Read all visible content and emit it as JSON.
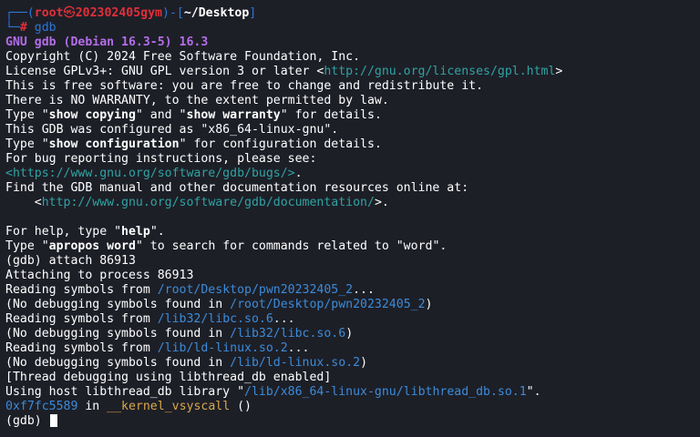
{
  "prompt": {
    "corner_top": "┌──(",
    "user": "root",
    "at": "㉿",
    "host": "202302405gym",
    "sep": ")-[",
    "cwd": "~/Desktop",
    "close": "]",
    "corner_bottom": "└─",
    "hash": "#",
    "command": "gdb"
  },
  "banner": {
    "title": "GNU gdb (Debian 16.3-5) 16.3",
    "copyright": "Copyright (C) 2024 Free Software Foundation, Inc.",
    "license_pre": "License GPLv3+: GNU GPL version 3 or later <",
    "license_url": "http://gnu.org/licenses/gpl.html",
    "license_post": ">",
    "free": "This is free software: you are free to change and redistribute it.",
    "warranty": "There is NO WARRANTY, to the extent permitted by law.",
    "type_pre": "Type \"",
    "show_copying": "show copying",
    "and_mid": "\" and \"",
    "show_warranty": "show warranty",
    "details_post": "\" for details.",
    "configured": "This GDB was configured as \"x86_64-linux-gnu\".",
    "show_configuration": "show configuration",
    "config_post": "\" for configuration details.",
    "bug_intro": "For bug reporting instructions, please see:",
    "bug_url": "<https://www.gnu.org/software/gdb/bugs/>",
    "bug_post": ".",
    "manual_intro": "Find the GDB manual and other documentation resources online at:",
    "manual_indent": "    <",
    "manual_url": "http://www.gnu.org/software/gdb/documentation/",
    "manual_post": ">.",
    "help_pre": "For help, type \"",
    "help": "help",
    "help_post": "\".",
    "apropos_pre": "Type \"",
    "apropos": "apropos word",
    "apropos_post": "\" to search for commands related to \"word\"."
  },
  "session": {
    "cmd_attach": "(gdb) attach 86913",
    "attaching": "Attaching to process 86913",
    "reading_pre": "Reading symbols from ",
    "reading_post": "...",
    "nodebug_pre": "(No debugging symbols found in ",
    "nodebug_post": ")",
    "path_bin": "/root/Desktop/pwn20232405_2",
    "path_libc": "/lib32/libc.so.6",
    "path_ld": "/lib/ld-linux.so.2",
    "thread_debug": "[Thread debugging using libthread_db enabled]",
    "host_lib_pre": "Using host libthread_db library \"",
    "host_lib_path": "/lib/x86_64-linux-gnu/libthread_db.so.1",
    "host_lib_post": "\".",
    "frame_addr": "0xf7fc5589",
    "frame_in": " in ",
    "frame_fn": "__kernel_vsyscall",
    "frame_post": " ()",
    "final_prompt": "(gdb) "
  },
  "colors": {
    "background": "#1d1f27",
    "prompt_blue": "#2c76d6",
    "prompt_red": "#e0303a",
    "gdb_purple": "#b36de8",
    "url_teal": "#2fa3a3",
    "path_blue": "#3c8bd9",
    "function_yellow": "#d9a74a"
  }
}
